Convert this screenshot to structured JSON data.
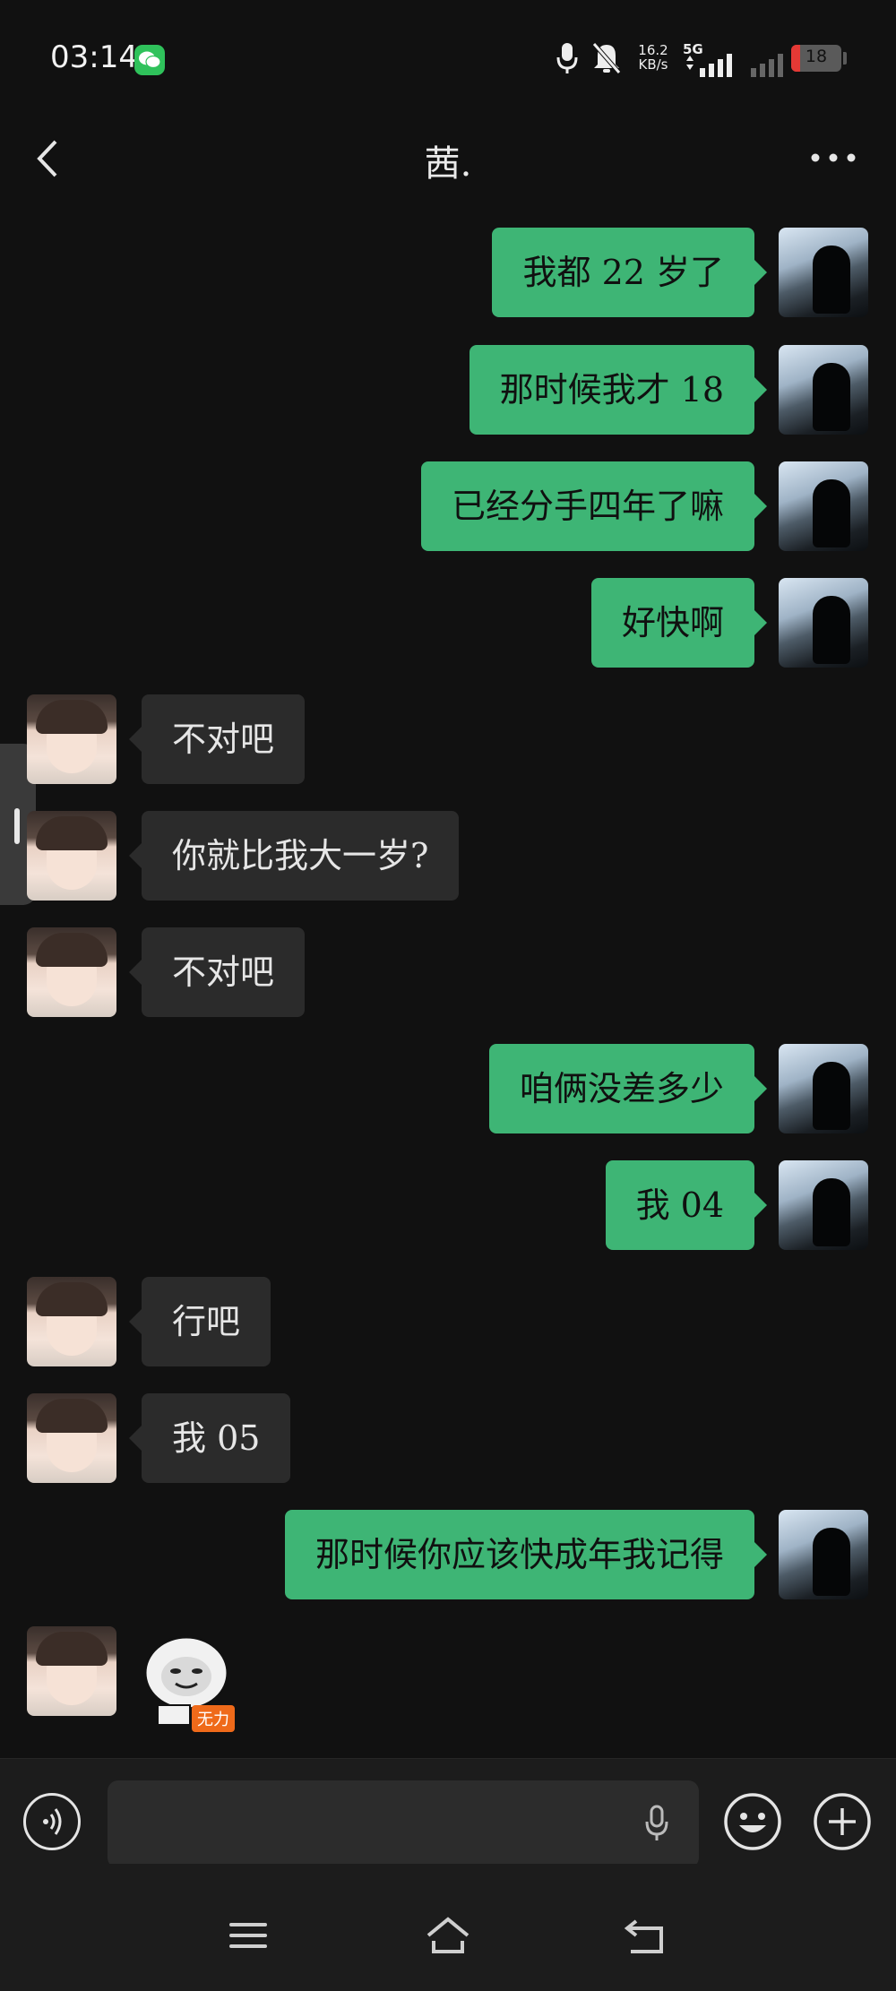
{
  "status_bar": {
    "time": "03:14",
    "net_speed_value": "16.2",
    "net_speed_unit": "KB/s",
    "network_type": "5G",
    "battery_level": "18",
    "battery_fraction": 0.18,
    "battery_color": "#e53935",
    "icons": [
      "wechat-icon",
      "mic-icon",
      "bell-off-icon",
      "signal-icon",
      "signal-icon",
      "battery-icon"
    ]
  },
  "header": {
    "title": "茜.",
    "back_icon": "chevron-left-icon",
    "more_icon": "more-dots-icon"
  },
  "messages": [
    {
      "sender": "me",
      "text": "我都 22 岁了"
    },
    {
      "sender": "me",
      "text": "那时候我才 18"
    },
    {
      "sender": "me",
      "text": "已经分手四年了嘛"
    },
    {
      "sender": "me",
      "text": "好快啊"
    },
    {
      "sender": "her",
      "text": "不对吧"
    },
    {
      "sender": "her",
      "text": "你就比我大一岁?"
    },
    {
      "sender": "her",
      "text": "不对吧"
    },
    {
      "sender": "me",
      "text": "咱俩没差多少"
    },
    {
      "sender": "me",
      "text": "我 04"
    },
    {
      "sender": "her",
      "text": "行吧"
    },
    {
      "sender": "her",
      "text": "我 05"
    },
    {
      "sender": "me",
      "text": "那时候你应该快成年我记得"
    },
    {
      "sender": "her",
      "sticker": "无力"
    }
  ],
  "input_bar": {
    "voice_icon": "voice-icon",
    "mic_icon": "mic-icon",
    "emoji_icon": "emoji-icon",
    "plus_icon": "plus-icon"
  },
  "nav_bar": {
    "icons": [
      "menu-icon",
      "home-icon",
      "back-icon"
    ]
  },
  "colors": {
    "background": "#111111",
    "my_bubble": "#3eb575",
    "her_bubble": "#2b2b2b",
    "wechat_green": "#2fc25b"
  }
}
